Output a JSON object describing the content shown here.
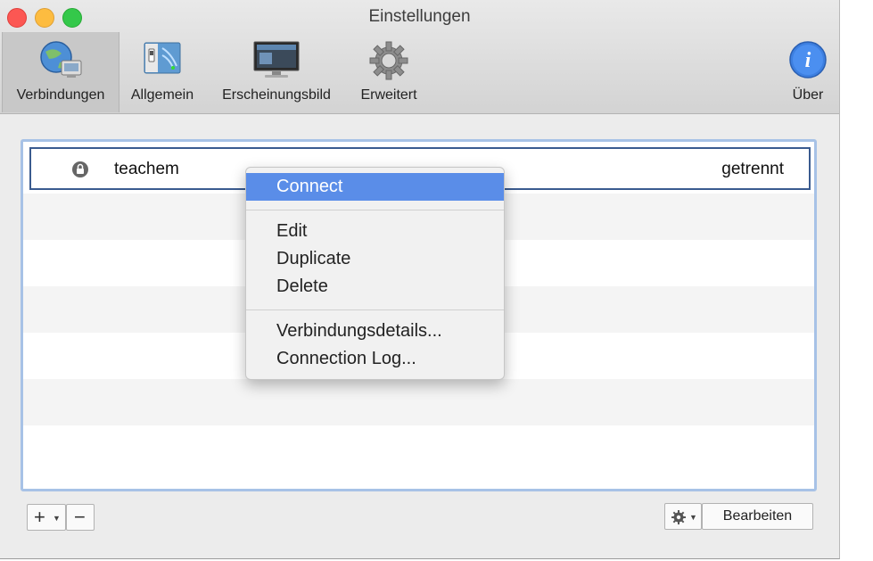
{
  "window": {
    "title": "Einstellungen"
  },
  "toolbar": {
    "items": [
      {
        "label": "Verbindungen",
        "icon": "network-globe-icon"
      },
      {
        "label": "Allgemein",
        "icon": "general-switch-icon"
      },
      {
        "label": "Erscheinungsbild",
        "icon": "monitor-icon"
      },
      {
        "label": "Erweitert",
        "icon": "gear-icon"
      },
      {
        "label": "Über",
        "icon": "info-icon"
      }
    ]
  },
  "connections": [
    {
      "name": "teachem",
      "status": "getrennt",
      "icon": "lock-icon"
    }
  ],
  "context_menu": {
    "items": [
      "Connect",
      "Edit",
      "Duplicate",
      "Delete",
      "Verbindungsdetails...",
      "Connection Log..."
    ],
    "highlighted": "Connect"
  },
  "bottom_bar": {
    "add": "+",
    "remove": "−",
    "edit_label": "Bearbeiten"
  },
  "colors": {
    "menu_highlight": "#5a8de8",
    "selection_border": "#3a5b8f",
    "panel_border": "#a7c2e6"
  }
}
